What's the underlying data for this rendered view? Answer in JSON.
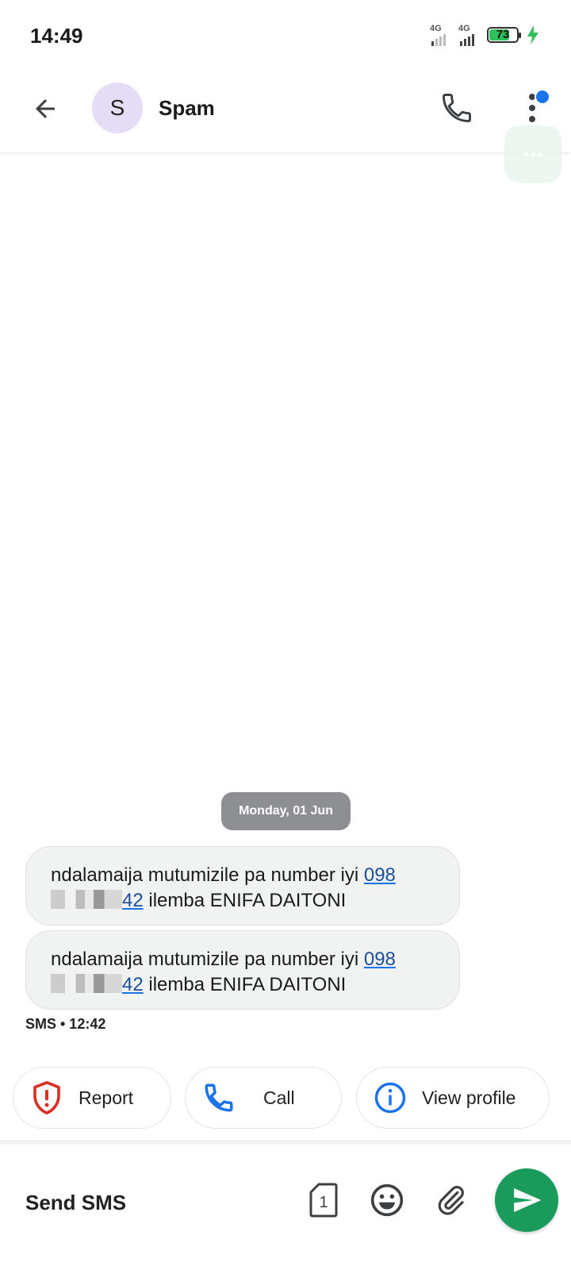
{
  "status_bar": {
    "time": "14:49",
    "network_1": "4G",
    "network_2": "4G",
    "battery_level": "73"
  },
  "app_bar": {
    "avatar_letter": "S",
    "contact_name": "Spam"
  },
  "conversation": {
    "date_chip": "Monday, 01 Jun",
    "messages": [
      {
        "text_prefix": "ndalamaija mutumizile pa number iyi ",
        "phone_start": "098",
        "phone_end": "42",
        "text_suffix": " ilemba ENIFA DAITONI"
      },
      {
        "text_prefix": "ndalamaija mutumizile pa number iyi ",
        "phone_start": "098",
        "phone_end": "42",
        "text_suffix": " ilemba ENIFA DAITONI"
      }
    ],
    "meta": "SMS • 12:42"
  },
  "actions": {
    "report_label": "Report",
    "call_label": "Call",
    "view_profile_label": "View profile"
  },
  "compose": {
    "placeholder": "Send SMS",
    "sim_slot": "1"
  },
  "icons": {
    "back": "arrow-left-icon",
    "phone": "phone-icon",
    "more": "more-vert-icon",
    "report": "shield-alert-icon",
    "info": "info-icon",
    "sim": "sim-card-icon",
    "emoji": "emoji-icon",
    "attach": "paperclip-icon",
    "send": "send-icon"
  },
  "colors": {
    "accent_blue": "#1a73e8",
    "send_green": "#1a9b5c",
    "report_red": "#d93025",
    "avatar_bg": "#e5dcf5",
    "bubble_bg": "#f1f2f2"
  }
}
